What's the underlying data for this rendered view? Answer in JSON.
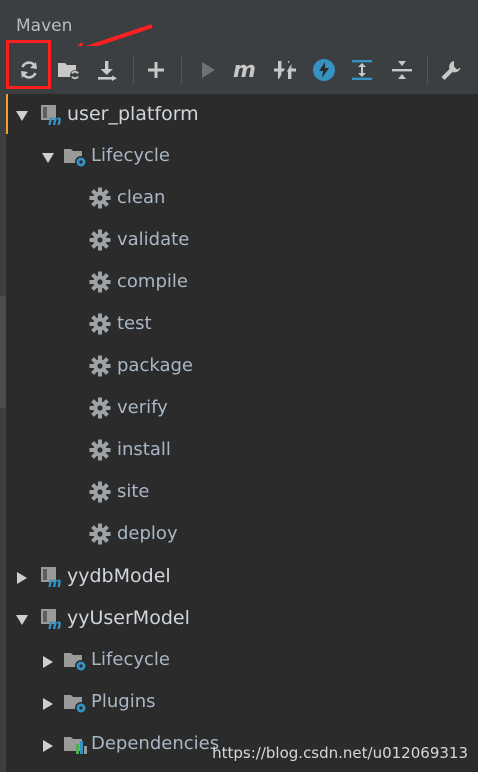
{
  "panel": {
    "title": "Maven"
  },
  "toolbar": {
    "buttons": [
      {
        "name": "reload-all-projects-button",
        "icon": "refresh-icon"
      },
      {
        "name": "generate-sources-button",
        "icon": "folder-refresh-icon"
      },
      {
        "name": "download-sources-button",
        "icon": "download-icon"
      },
      {
        "name": "add-project-button",
        "icon": "plus-icon"
      },
      {
        "name": "run-maven-build-button",
        "icon": "play-icon"
      },
      {
        "name": "execute-goal-button",
        "icon": "maven-m-icon"
      },
      {
        "name": "toggle-offline-mode-button",
        "icon": "offline-icon"
      },
      {
        "name": "skip-tests-button",
        "icon": "lightning-icon"
      },
      {
        "name": "show-dependencies-button",
        "icon": "expand-icon"
      },
      {
        "name": "collapse-all-button",
        "icon": "collapse-icon"
      },
      {
        "name": "settings-button",
        "icon": "wrench-icon"
      }
    ]
  },
  "tree": {
    "projects": [
      {
        "label": "user_platform",
        "expanded": true,
        "selected": true,
        "lifecycle": {
          "label": "Lifecycle",
          "goals": [
            "clean",
            "validate",
            "compile",
            "test",
            "package",
            "verify",
            "install",
            "site",
            "deploy"
          ]
        }
      },
      {
        "label": "yydbModel",
        "expanded": false
      },
      {
        "label": "yyUserModel",
        "expanded": true,
        "children": [
          {
            "label": "Lifecycle",
            "icon": "lifecycle-folder-icon"
          },
          {
            "label": "Plugins",
            "icon": "plugins-folder-icon"
          },
          {
            "label": "Dependencies",
            "icon": "dependencies-folder-icon"
          }
        ]
      }
    ]
  },
  "watermark": "https://blog.csdn.net/u012069313",
  "colors": {
    "background": "#2b2b2b",
    "toolbar": "#3c3f41",
    "text": "#a9b7c6",
    "highlight": "#ff1e1e",
    "accent": "#f0a030",
    "maven_blue": "#3592c4"
  }
}
